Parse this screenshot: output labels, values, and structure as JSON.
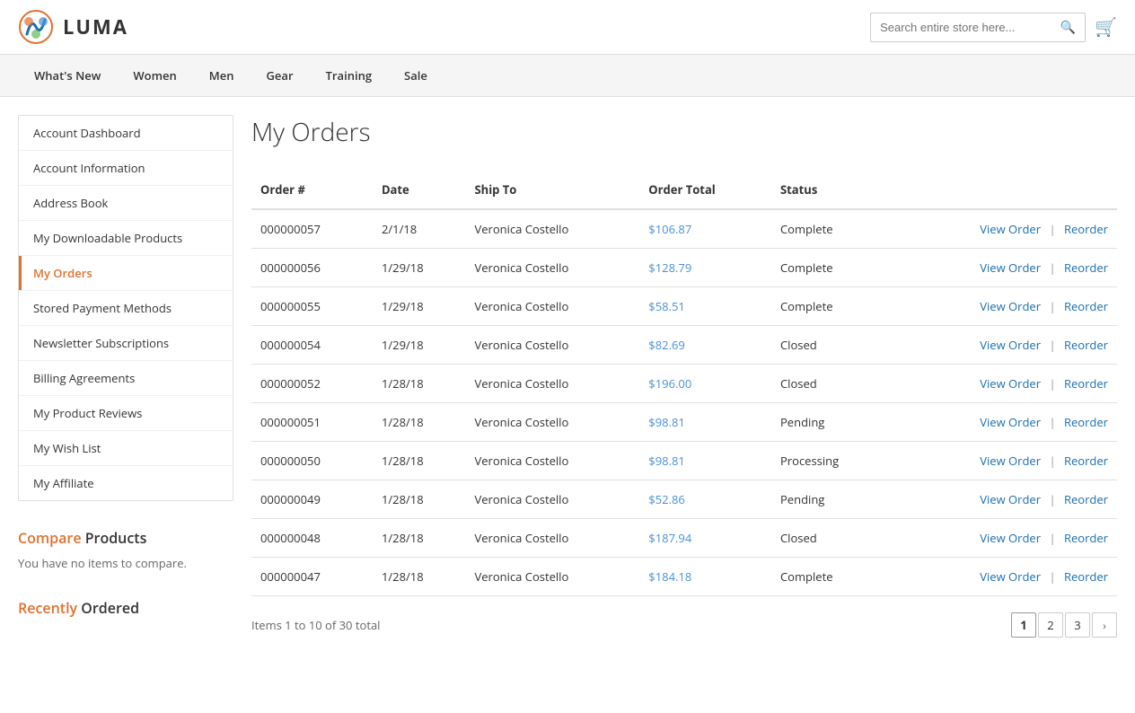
{
  "header": {
    "logo_text": "LUMA",
    "search_placeholder": "Search entire store here...",
    "cart_label": "cart"
  },
  "nav": {
    "items": [
      {
        "label": "What's New"
      },
      {
        "label": "Women"
      },
      {
        "label": "Men"
      },
      {
        "label": "Gear"
      },
      {
        "label": "Training"
      },
      {
        "label": "Sale"
      }
    ]
  },
  "sidebar": {
    "menu_items": [
      {
        "label": "Account Dashboard",
        "active": false
      },
      {
        "label": "Account Information",
        "active": false
      },
      {
        "label": "Address Book",
        "active": false
      },
      {
        "label": "My Downloadable Products",
        "active": false
      },
      {
        "label": "My Orders",
        "active": true
      },
      {
        "label": "Stored Payment Methods",
        "active": false
      },
      {
        "label": "Newsletter Subscriptions",
        "active": false
      },
      {
        "label": "Billing Agreements",
        "active": false
      },
      {
        "label": "My Product Reviews",
        "active": false
      },
      {
        "label": "My Wish List",
        "active": false
      },
      {
        "label": "My Affiliate",
        "active": false
      }
    ],
    "compare_title_part1": "Compare",
    "compare_title_part2": "Products",
    "compare_text": "You have no items to compare.",
    "recently_ordered_part1": "Recently",
    "recently_ordered_part2": "Ordered"
  },
  "orders": {
    "page_title": "My Orders",
    "columns": [
      "Order #",
      "Date",
      "Ship To",
      "Order Total",
      "Status",
      ""
    ],
    "rows": [
      {
        "order_num": "000000057",
        "date": "2/1/18",
        "ship_to": "Veronica Costello",
        "total": "$106.87",
        "status": "Complete"
      },
      {
        "order_num": "000000056",
        "date": "1/29/18",
        "ship_to": "Veronica Costello",
        "total": "$128.79",
        "status": "Complete"
      },
      {
        "order_num": "000000055",
        "date": "1/29/18",
        "ship_to": "Veronica Costello",
        "total": "$58.51",
        "status": "Complete"
      },
      {
        "order_num": "000000054",
        "date": "1/29/18",
        "ship_to": "Veronica Costello",
        "total": "$82.69",
        "status": "Closed"
      },
      {
        "order_num": "000000052",
        "date": "1/28/18",
        "ship_to": "Veronica Costello",
        "total": "$196.00",
        "status": "Closed"
      },
      {
        "order_num": "000000051",
        "date": "1/28/18",
        "ship_to": "Veronica Costello",
        "total": "$98.81",
        "status": "Pending"
      },
      {
        "order_num": "000000050",
        "date": "1/28/18",
        "ship_to": "Veronica Costello",
        "total": "$98.81",
        "status": "Processing"
      },
      {
        "order_num": "000000049",
        "date": "1/28/18",
        "ship_to": "Veronica Costello",
        "total": "$52.86",
        "status": "Pending"
      },
      {
        "order_num": "000000048",
        "date": "1/28/18",
        "ship_to": "Veronica Costello",
        "total": "$187.94",
        "status": "Closed"
      },
      {
        "order_num": "000000047",
        "date": "1/28/18",
        "ship_to": "Veronica Costello",
        "total": "$184.18",
        "status": "Complete"
      }
    ],
    "action_view": "View Order",
    "action_sep": "|",
    "action_reorder": "Reorder",
    "pagination_info": "Items 1 to 10 of 30 total",
    "pages": [
      "1",
      "2",
      "3"
    ],
    "next_label": "›"
  }
}
